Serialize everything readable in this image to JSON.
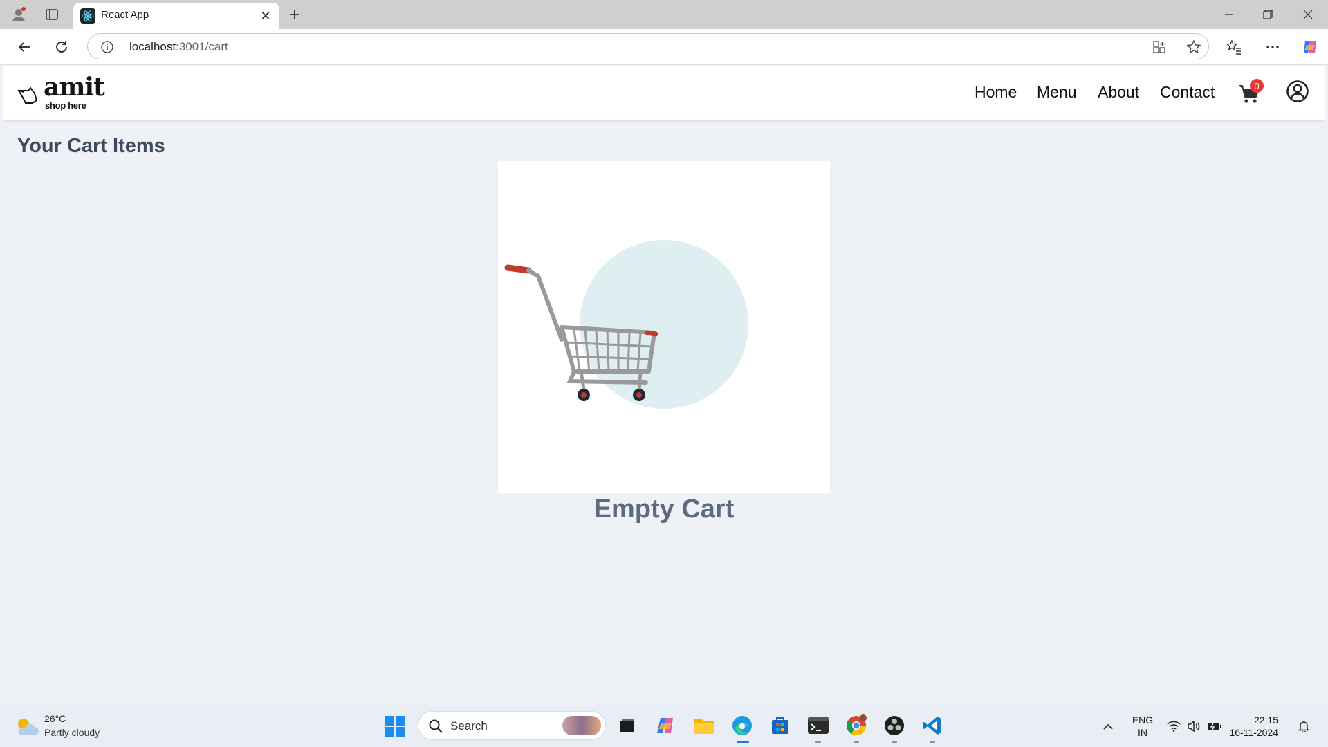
{
  "browser": {
    "tab_title": "React App",
    "url_host": "localhost",
    "url_path": ":3001/cart"
  },
  "site": {
    "logo_name": "amit",
    "logo_tagline": "shop here",
    "nav": [
      "Home",
      "Menu",
      "About",
      "Contact"
    ],
    "cart_count": "0"
  },
  "cart": {
    "title": "Your Cart Items",
    "empty_message": "Empty Cart"
  },
  "taskbar": {
    "temperature": "26°C",
    "weather": "Partly cloudy",
    "search_placeholder": "Search",
    "lang_1": "ENG",
    "lang_2": "IN",
    "time": "22:15",
    "date": "16-11-2024"
  },
  "colors": {
    "page_bg": "#eef2f7",
    "badge": "#e53935",
    "title_text": "#3d4a5c",
    "empty_text": "#5d6b80"
  }
}
